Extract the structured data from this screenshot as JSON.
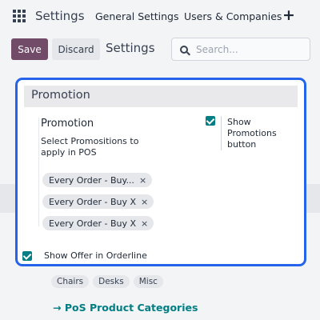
{
  "topnav": {
    "app_name": "Settings",
    "menu": [
      "General Settings",
      "Users & Companies"
    ],
    "new_icon": "+"
  },
  "controls": {
    "save_label": "Save",
    "discard_label": "Discard",
    "page_title": "Settings",
    "search_placeholder": "Search..."
  },
  "background": {
    "tags": [
      "Chairs",
      "Desks",
      "Misc"
    ],
    "link_label": "PoS Product Categories"
  },
  "popup": {
    "header": "Promotion",
    "field_title": "Promotion",
    "field_desc": "Select Promositions to apply in POS",
    "tags": [
      {
        "label": "Every Order - Buy...",
        "remove": "×"
      },
      {
        "label": "Every Order - Buy X",
        "remove": "×"
      },
      {
        "label": "Every Order - Buy X",
        "remove": "×"
      }
    ],
    "show_promotions_label": "Show Promotions button",
    "show_promotions_checked": true,
    "show_offer_label": "Show Offer in Orderline",
    "show_offer_checked": true
  },
  "colors": {
    "primary": "#714b67",
    "checkbox": "#017e84",
    "focus_border": "#2563eb"
  }
}
